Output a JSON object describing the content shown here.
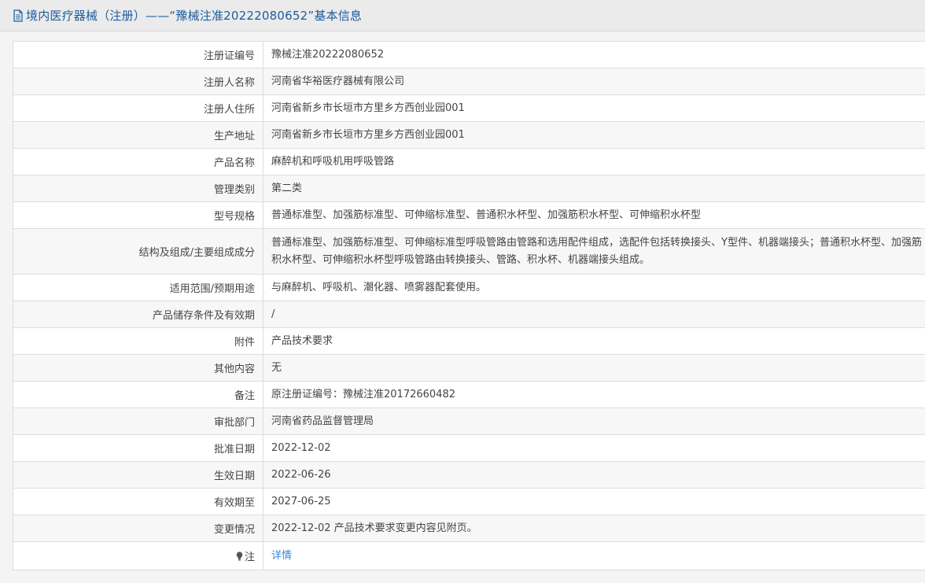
{
  "header": {
    "title": "境内医疗器械（注册）——“豫械注准20222080652”基本信息",
    "icon": "document-icon"
  },
  "rows": [
    {
      "label": "注册证编号",
      "value": "豫械注准20222080652"
    },
    {
      "label": "注册人名称",
      "value": "河南省华裕医疗器械有限公司"
    },
    {
      "label": "注册人住所",
      "value": "河南省新乡市长垣市方里乡方西创业园001"
    },
    {
      "label": "生产地址",
      "value": "河南省新乡市长垣市方里乡方西创业园001"
    },
    {
      "label": "产品名称",
      "value": "麻醉机和呼吸机用呼吸管路"
    },
    {
      "label": "管理类别",
      "value": "第二类"
    },
    {
      "label": "型号规格",
      "value": "普通标准型、加强筋标准型、可伸缩标准型、普通积水杯型、加强筋积水杯型、可伸缩积水杯型"
    },
    {
      "label": "结构及组成/主要组成成分",
      "value": "普通标准型、加强筋标准型、可伸缩标准型呼吸管路由管路和选用配件组成，选配件包括转换接头、Y型件、机器端接头；普通积水杯型、加强筋积水杯型、可伸缩积水杯型呼吸管路由转换接头、管路、积水杯、机器端接头组成。"
    },
    {
      "label": "适用范围/预期用途",
      "value": "与麻醉机、呼吸机、潮化器、喷雾器配套使用。"
    },
    {
      "label": "产品储存条件及有效期",
      "value": "/"
    },
    {
      "label": "附件",
      "value": "产品技术要求"
    },
    {
      "label": "其他内容",
      "value": "无"
    },
    {
      "label": "备注",
      "value": "原注册证编号：豫械注准20172660482"
    },
    {
      "label": "审批部门",
      "value": "河南省药品监督管理局"
    },
    {
      "label": "批准日期",
      "value": "2022-12-02"
    },
    {
      "label": "生效日期",
      "value": "2022-06-26"
    },
    {
      "label": "有效期至",
      "value": "2027-06-25"
    },
    {
      "label": "变更情况",
      "value": "2022-12-02 产品技术要求变更内容见附页。"
    }
  ],
  "note": {
    "label": "注",
    "icon": "lightbulb-icon",
    "link_text": "详情"
  },
  "colors": {
    "title": "#1c5b9f",
    "link": "#3a87d2",
    "border": "#dddddd",
    "header_bg": "#ebebeb"
  }
}
